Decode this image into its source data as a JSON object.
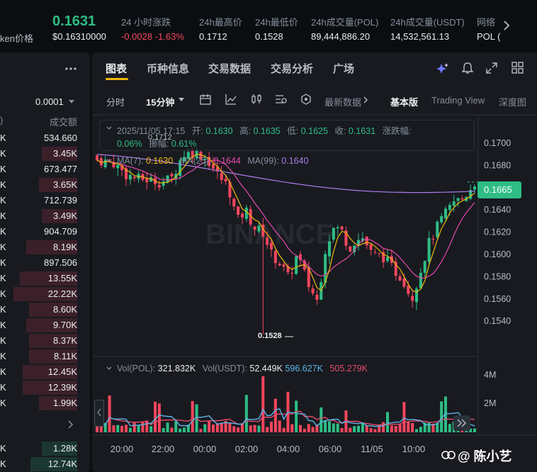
{
  "ticker": {
    "left_label": "ken价格",
    "price": "0.1631",
    "price_usd": "$0.16310000",
    "change_label": "24 小时涨跌",
    "change_value": "-0.0028 -1.63%",
    "high_label": "24h最高价",
    "high_value": "0.1712",
    "low_label": "24h最低价",
    "low_value": "0.1528",
    "vol_pol_label": "24h成交量(POL)",
    "vol_pol_value": "89,444,886.20",
    "vol_usdt_label": "24h成交量(USDT)",
    "vol_usdt_value": "14,532,561.13",
    "network_label": "网络",
    "network_value": "POL (",
    "next_icon": "chevron-right-icon"
  },
  "left_panel": {
    "menu_icon": "more-icon",
    "precision": "0.0001",
    "col_left": ")",
    "col_right": "成交额",
    "rows": [
      {
        "k": "K",
        "v": "534.660",
        "fill": 0.0
      },
      {
        "k": "K",
        "v": "3.45K",
        "fill": 0.55
      },
      {
        "k": "K",
        "v": "673.477",
        "fill": 0.0
      },
      {
        "k": "K",
        "v": "3.65K",
        "fill": 0.6
      },
      {
        "k": "K",
        "v": "712.739",
        "fill": 0.0
      },
      {
        "k": "K",
        "v": "3.49K",
        "fill": 0.55
      },
      {
        "k": "K",
        "v": "904.709",
        "fill": 0.0
      },
      {
        "k": "K",
        "v": "8.19K",
        "fill": 0.8
      },
      {
        "k": "K",
        "v": "897.506",
        "fill": 0.0
      },
      {
        "k": "K",
        "v": "13.55K",
        "fill": 0.9
      },
      {
        "k": "K",
        "v": "22.22K",
        "fill": 1.0
      },
      {
        "k": "K",
        "v": "8.60K",
        "fill": 0.75
      },
      {
        "k": "K",
        "v": "9.70K",
        "fill": 0.8
      },
      {
        "k": "K",
        "v": "8.37K",
        "fill": 0.75
      },
      {
        "k": "K",
        "v": "8.11K",
        "fill": 0.75
      },
      {
        "k": "K",
        "v": "12.45K",
        "fill": 0.85
      },
      {
        "k": "K",
        "v": "12.39K",
        "fill": 0.85
      },
      {
        "k": "K",
        "v": "1.99K",
        "fill": 0.6
      }
    ],
    "bottom_rows": [
      {
        "k": "K",
        "v": "1.28K"
      },
      {
        "k": "K",
        "v": "12.74K"
      }
    ]
  },
  "tabs": [
    "图表",
    "币种信息",
    "交易数据",
    "交易分析",
    "广场"
  ],
  "toolbar": {
    "time_label": "分时",
    "interval": "15分钟",
    "latest_data": "最新数据",
    "basic": "基本版",
    "trading_view": "Trading View",
    "depth": "深度图"
  },
  "info_box": {
    "date": "2025/11/05 17:15",
    "open_label": "开:",
    "open": "0.1630",
    "high_label": "高:",
    "high": "0.1635",
    "low_label": "低:",
    "low": "0.1625",
    "close_label": "收:",
    "close": "0.1631",
    "change_label": "涨跌幅:",
    "change_value": "0.06%",
    "amp_label": "振幅:",
    "amp_value": "0.61%",
    "overlap_text": "0.1712"
  },
  "ma": {
    "ma7_label": "MA(7):",
    "ma7": "0.1630",
    "ma25_label": "MA(25):",
    "ma25": "0.1644",
    "ma99_label": "MA(99):",
    "ma99": "0.1640",
    "ma7_color": "#f0b90b",
    "ma25_color": "#e54bab",
    "ma99_color": "#a87de6"
  },
  "vol": {
    "vol_pol_label": "Vol(POL):",
    "vol_pol": "321.832K",
    "vol_usdt_label": "Vol(USDT):",
    "vol_usdt": "52.449K",
    "ma5": "596.627K",
    "ma10": "505.279K"
  },
  "chart_data": {
    "type": "candlestick",
    "interval": "15m",
    "y_ticks": [
      "0.1700",
      "0.1680",
      "0.1660",
      "0.1640",
      "0.1620",
      "0.1600",
      "0.1580",
      "0.1560",
      "0.1540"
    ],
    "ylim": [
      0.1528,
      0.1714
    ],
    "current_price": "0.1665",
    "low_marker": "0.1528",
    "vol_ticks": [
      "4M",
      "2M"
    ],
    "x_ticks": [
      "20:00",
      "22:00",
      "00:00",
      "02:00",
      "04:00",
      "06:00",
      "11/05",
      "10:00"
    ],
    "series": [
      {
        "name": "MA(7)",
        "color": "#f0b90b"
      },
      {
        "name": "MA(25)",
        "color": "#e54bab"
      },
      {
        "name": "MA(99)",
        "color": "#a87de6"
      }
    ]
  },
  "watermark": "@ 陈小艺",
  "colors": {
    "up": "#2ebd85",
    "down": "#f6465d",
    "bg": "#181a20"
  }
}
